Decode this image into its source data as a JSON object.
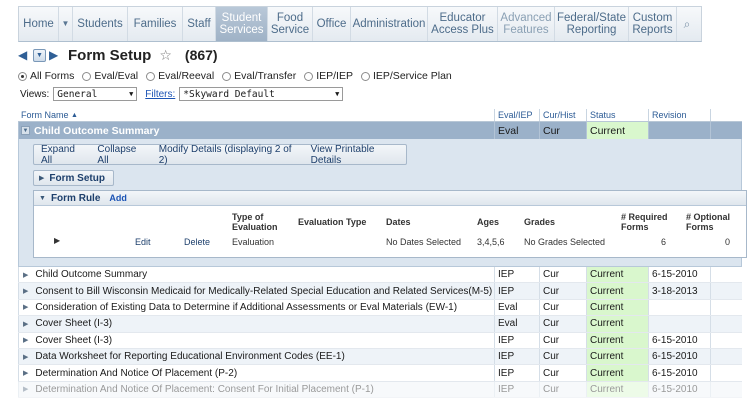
{
  "nav": {
    "home": "Home",
    "students": "Students",
    "families": "Families",
    "staff": "Staff",
    "student_services_1": "Student",
    "student_services_2": "Services",
    "food_1": "Food",
    "food_2": "Service",
    "office": "Office",
    "administration": "Administration",
    "educator_1": "Educator",
    "educator_2": "Access Plus",
    "advanced_1": "Advanced",
    "advanced_2": "Features",
    "federal_1": "Federal/State",
    "federal_2": "Reporting",
    "custom_1": "Custom",
    "custom_2": "Reports"
  },
  "header": {
    "title": "Form Setup",
    "count": "(867)"
  },
  "filters": {
    "radios": [
      "All Forms",
      "Eval/Eval",
      "Eval/Reeval",
      "Eval/Transfer",
      "IEP/IEP",
      "IEP/Service Plan"
    ],
    "views_label": "Views:",
    "views_value": "General",
    "filters_label": "Filters:",
    "filters_value": "*Skyward Default"
  },
  "columns": {
    "name": "Form Name",
    "eval": "Eval/IEP",
    "cur": "Cur/Hist",
    "status": "Status",
    "revision": "Revision"
  },
  "selected": {
    "name": "Child Outcome Summary",
    "eval": "Eval",
    "cur": "Cur",
    "status": "Current",
    "revision": ""
  },
  "actions": {
    "expand": "Expand All",
    "collapse": "Collapse All",
    "modify": "Modify Details (displaying 2 of 2)",
    "print": "View Printable Details",
    "form_setup": "Form Setup",
    "form_rule": "Form Rule",
    "add": "Add"
  },
  "rule": {
    "headers": {
      "type_1": "Type of",
      "type_2": "Evaluation",
      "eval_type": "Evaluation Type",
      "dates": "Dates",
      "ages": "Ages",
      "grades": "Grades",
      "required_1": "# Required",
      "required_2": "Forms",
      "optional_1": "# Optional",
      "optional_2": "Forms"
    },
    "row": {
      "edit": "Edit",
      "delete": "Delete",
      "type": "Evaluation",
      "dates": "No Dates Selected",
      "ages": "3,4,5,6",
      "grades": "No Grades Selected",
      "required": "6",
      "optional": "0"
    }
  },
  "rows": [
    {
      "name": "Child Outcome Summary",
      "eval": "IEP",
      "cur": "Cur",
      "status": "Current",
      "revision": "6-15-2010"
    },
    {
      "name": "Consent to Bill Wisconsin Medicaid for Medically-Related Special Education and Related Services(M-5)",
      "eval": "IEP",
      "cur": "Cur",
      "status": "Current",
      "revision": "3-18-2013"
    },
    {
      "name": "Consideration of Existing Data to Determine if Additional Assessments or Eval Materials (EW-1)",
      "eval": "Eval",
      "cur": "Cur",
      "status": "Current",
      "revision": ""
    },
    {
      "name": "Cover Sheet (I-3)",
      "eval": "Eval",
      "cur": "Cur",
      "status": "Current",
      "revision": ""
    },
    {
      "name": "Cover Sheet (I-3)",
      "eval": "IEP",
      "cur": "Cur",
      "status": "Current",
      "revision": "6-15-2010"
    },
    {
      "name": "Data Worksheet for Reporting Educational Environment Codes (EE-1)",
      "eval": "IEP",
      "cur": "Cur",
      "status": "Current",
      "revision": "6-15-2010"
    },
    {
      "name": "Determination And Notice Of Placement (P-2)",
      "eval": "IEP",
      "cur": "Cur",
      "status": "Current",
      "revision": "6-15-2010"
    },
    {
      "name": "Determination And Notice Of Placement: Consent For Initial Placement (P-1)",
      "eval": "IEP",
      "cur": "Cur",
      "status": "Current",
      "revision": "6-15-2010"
    }
  ]
}
